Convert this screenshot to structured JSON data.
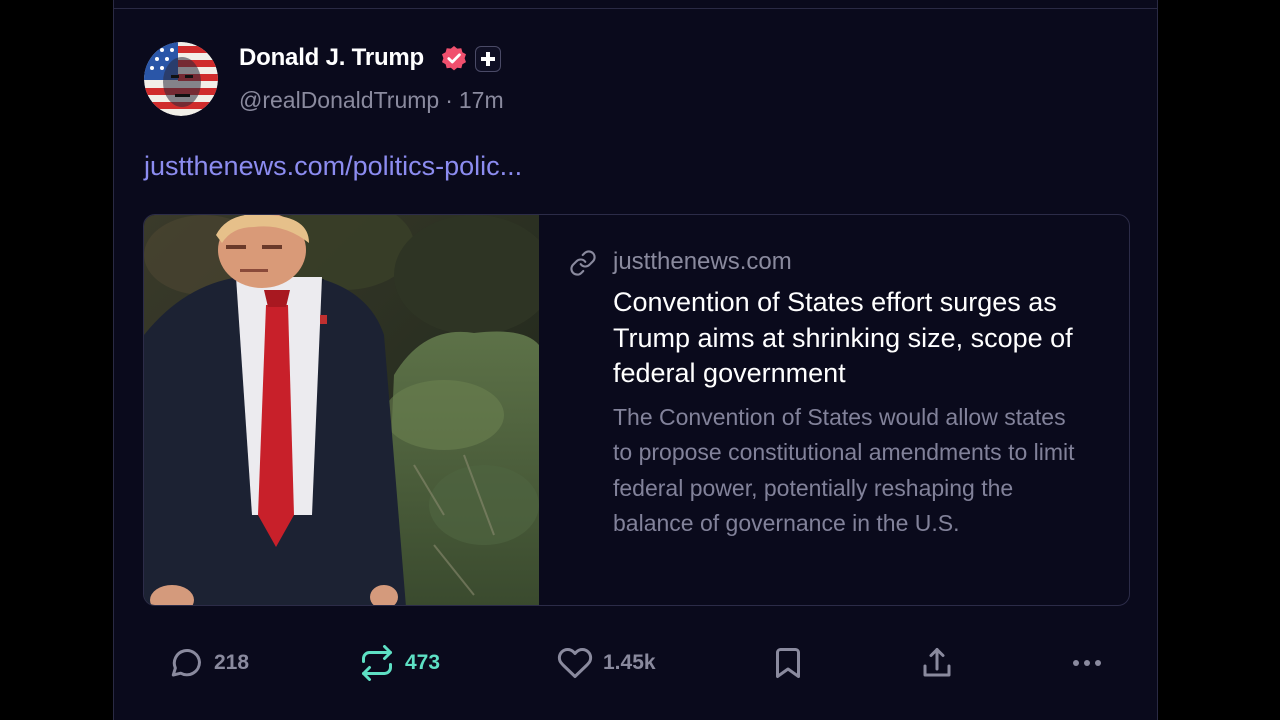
{
  "post": {
    "author": {
      "name": "Donald J. Trump",
      "handle": "@realDonaldTrump",
      "separator": "·",
      "time": "17m",
      "avatar_icon": "avatar-flag-portrait",
      "verified_icon": "verified-badge-icon",
      "plus_icon": "plus-badge-icon"
    },
    "link_text": "justthenews.com/politics-polic...",
    "card": {
      "image_icon": "article-photo",
      "link_icon": "link-icon",
      "domain": "justthenews.com",
      "title": "Convention of States effort surges as Trump aims at shrinking size, scope of federal government",
      "description": "The Convention of States would allow states to propose constitutional amendments to limit federal power, potentially reshaping the balance of governance in the U.S."
    },
    "actions": {
      "replies": {
        "icon": "reply-icon",
        "count": "218"
      },
      "reposts": {
        "icon": "repost-icon",
        "count": "473",
        "active_color": "#5ee0c4"
      },
      "likes": {
        "icon": "heart-icon",
        "count": "1.45k"
      },
      "bookmark": {
        "icon": "bookmark-icon"
      },
      "share": {
        "icon": "share-icon"
      },
      "more": {
        "icon": "more-icon"
      }
    }
  },
  "colors": {
    "background": "#0a0a1c",
    "link": "#8c8cf0",
    "verified": "#f0506e",
    "muted_text": "#8a8a9e"
  }
}
